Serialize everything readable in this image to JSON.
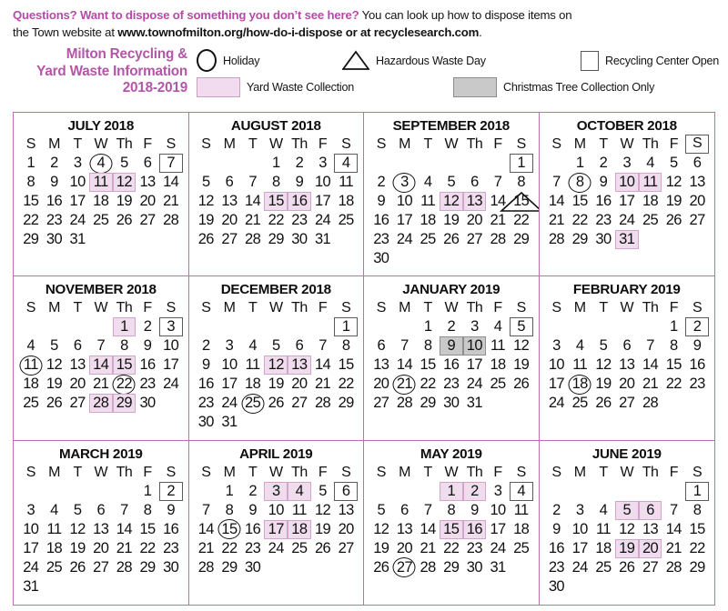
{
  "banner": {
    "question": "Questions? Want to dispose of something you don’t see here?",
    "rest1": " You can look up how to dispose items on",
    "line2_pre": "the Town website at ",
    "url": "www.townofmilton.org/how-do-i-dispose or at recyclesearch.com",
    "line2_post": "."
  },
  "title": {
    "line1": "Milton Recycling &",
    "line2": "Yard Waste Information",
    "line3": "2018-2019"
  },
  "legend": {
    "holiday": "Holiday",
    "hazardous": "Hazardous Waste Day",
    "recycling_center": "Recycling Center Open",
    "yard_waste": "Yard Waste Collection",
    "christmas_tree": "Christmas Tree Collection Only"
  },
  "colors": {
    "accent_purple": "#b356a7",
    "grid_purple": "#bb6fb5",
    "yard_fill": "#efdced",
    "yard_border": "#d3a5cd",
    "tree_fill": "#c9c9c9",
    "tree_border": "#8f8f8f",
    "box_border": "#5a5a5a",
    "text": "#111111"
  },
  "weekday_headers": [
    "S",
    "M",
    "T",
    "W",
    "Th",
    "F",
    "S"
  ],
  "months": [
    {
      "name": "JULY 2018",
      "first_weekday": 0,
      "days": 31,
      "header_boxed": [],
      "circled": [
        4
      ],
      "boxed": [
        7
      ],
      "yard": [
        11,
        12
      ],
      "tree": [],
      "triangle": []
    },
    {
      "name": "AUGUST 2018",
      "first_weekday": 3,
      "days": 31,
      "header_boxed": [],
      "circled": [],
      "boxed": [
        4
      ],
      "yard": [
        15,
        16
      ],
      "tree": [],
      "triangle": []
    },
    {
      "name": "SEPTEMBER 2018",
      "first_weekday": 6,
      "days": 30,
      "header_boxed": [],
      "circled": [
        3
      ],
      "boxed": [
        1
      ],
      "yard": [
        12,
        13
      ],
      "tree": [],
      "triangle": [
        15
      ]
    },
    {
      "name": "OCTOBER 2018",
      "first_weekday": 1,
      "days": 31,
      "header_boxed": [
        6
      ],
      "circled": [
        8
      ],
      "boxed": [],
      "yard": [
        10,
        11,
        31
      ],
      "tree": [],
      "triangle": []
    },
    {
      "name": "NOVEMBER 2018",
      "first_weekday": 4,
      "days": 30,
      "header_boxed": [],
      "circled": [
        11,
        22
      ],
      "boxed": [
        3
      ],
      "yard": [
        1,
        14,
        15,
        28,
        29
      ],
      "tree": [],
      "triangle": []
    },
    {
      "name": "DECEMBER 2018",
      "first_weekday": 6,
      "days": 31,
      "header_boxed": [],
      "circled": [
        25
      ],
      "boxed": [
        1
      ],
      "yard": [
        12,
        13
      ],
      "tree": [],
      "triangle": []
    },
    {
      "name": "JANUARY 2019",
      "first_weekday": 2,
      "days": 31,
      "header_boxed": [],
      "circled": [
        21
      ],
      "boxed": [
        5
      ],
      "yard": [],
      "tree": [
        9,
        10
      ],
      "triangle": []
    },
    {
      "name": "FEBRUARY 2019",
      "first_weekday": 5,
      "days": 28,
      "header_boxed": [],
      "circled": [
        18
      ],
      "boxed": [
        2
      ],
      "yard": [],
      "tree": [],
      "triangle": []
    },
    {
      "name": "MARCH 2019",
      "first_weekday": 5,
      "days": 31,
      "header_boxed": [],
      "circled": [],
      "boxed": [
        2
      ],
      "yard": [],
      "tree": [],
      "triangle": []
    },
    {
      "name": "APRIL 2019",
      "first_weekday": 1,
      "days": 30,
      "header_boxed": [],
      "circled": [
        15
      ],
      "boxed": [
        6
      ],
      "yard": [
        3,
        4,
        17,
        18
      ],
      "tree": [],
      "triangle": []
    },
    {
      "name": "MAY 2019",
      "first_weekday": 3,
      "days": 31,
      "header_boxed": [],
      "circled": [
        27
      ],
      "boxed": [
        4
      ],
      "yard": [
        1,
        2,
        15,
        16
      ],
      "tree": [],
      "triangle": []
    },
    {
      "name": "JUNE 2019",
      "first_weekday": 6,
      "days": 30,
      "header_boxed": [],
      "circled": [],
      "boxed": [
        1
      ],
      "yard": [
        5,
        6,
        19,
        20
      ],
      "tree": [],
      "triangle": []
    }
  ]
}
